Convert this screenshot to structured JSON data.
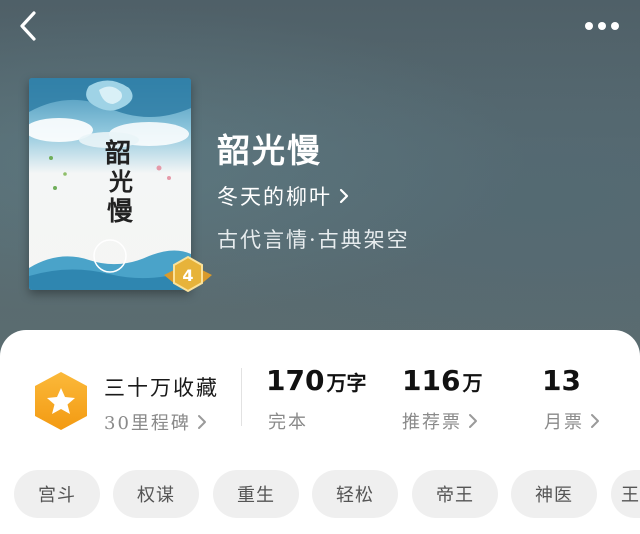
{
  "header": {
    "back_icon": "chevron-left-icon",
    "more_icon": "more-dots-icon"
  },
  "book": {
    "title": "韶光慢",
    "author": "冬天的柳叶",
    "genre": "古代言情·古典架空",
    "cover_title_art": "韶光慢",
    "level_badge": "4"
  },
  "stats": {
    "favorites_main": "三十万收藏",
    "favorites_sub": "30里程碑",
    "word_count_value": "170",
    "word_count_unit": "万字",
    "word_count_label": "完本",
    "recommend_value": "116",
    "recommend_unit": "万",
    "recommend_label": "推荐票",
    "monthly_value": "13",
    "monthly_label": "月票"
  },
  "tags": [
    "宫斗",
    "权谋",
    "重生",
    "轻松",
    "帝王",
    "神医",
    "王"
  ],
  "colors": {
    "accent_orange": "#f7a51e",
    "badge_gold": "#e7b33a"
  }
}
